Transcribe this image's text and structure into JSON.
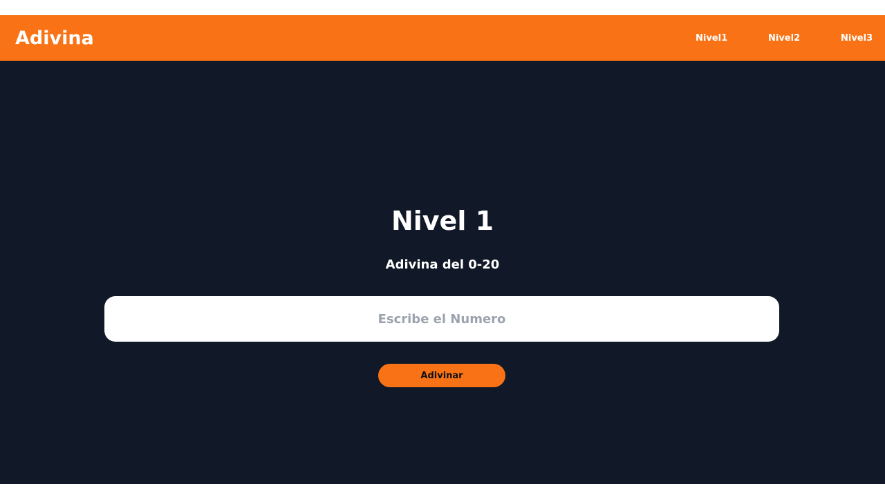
{
  "navbar": {
    "brand": "Adivina",
    "links": [
      {
        "label": "Nivel1"
      },
      {
        "label": "Nivel2"
      },
      {
        "label": "Nivel3"
      }
    ]
  },
  "main": {
    "title": "Nivel 1",
    "subtitle": "Adivina del 0-20",
    "input": {
      "value": "",
      "placeholder": "Escribe el Numero"
    },
    "button_label": "Adivinar"
  },
  "colors": {
    "accent": "#f97316",
    "background": "#111827",
    "placeholder": "#9ca3af"
  }
}
